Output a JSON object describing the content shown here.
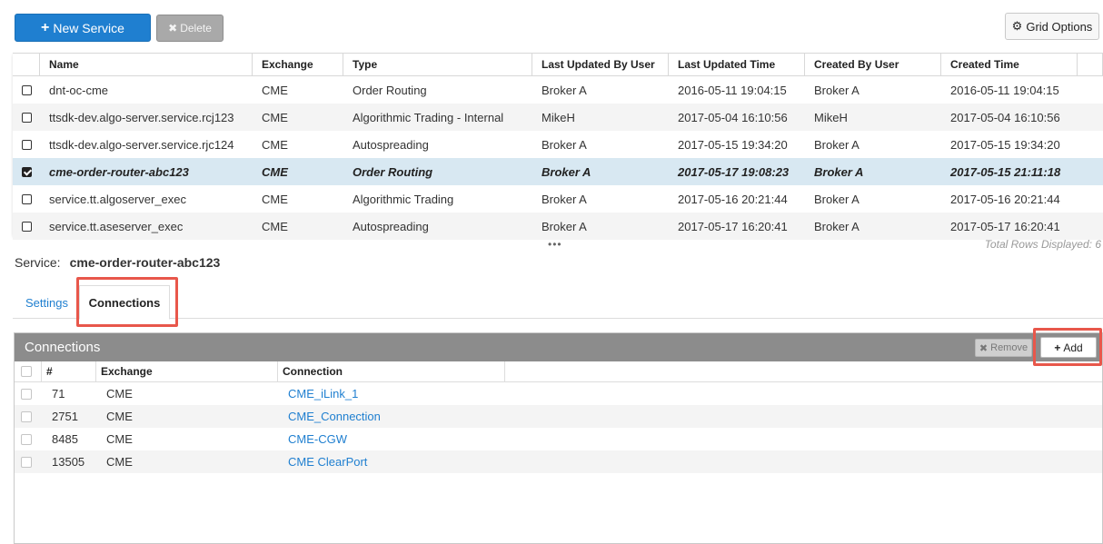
{
  "toolbar": {
    "new_service_label": "New Service",
    "delete_label": "Delete",
    "grid_options_label": "Grid Options"
  },
  "services": {
    "columns": [
      "Name",
      "Exchange",
      "Type",
      "Last Updated By User",
      "Last Updated Time",
      "Created By User",
      "Created Time"
    ],
    "rows": [
      {
        "checked": false,
        "name": "dnt-oc-cme",
        "exchange": "CME",
        "type": "Order Routing",
        "last_updated_by": "Broker A",
        "last_updated_time": "2016-05-11 19:04:15",
        "created_by": "Broker A",
        "created_time": "2016-05-11 19:04:15"
      },
      {
        "checked": false,
        "name": "ttsdk-dev.algo-server.service.rcj123",
        "exchange": "CME",
        "type": "Algorithmic Trading - Internal",
        "last_updated_by": "MikeH",
        "last_updated_time": "2017-05-04 16:10:56",
        "created_by": "MikeH",
        "created_time": "2017-05-04 16:10:56"
      },
      {
        "checked": false,
        "name": "ttsdk-dev.algo-server.service.rjc124",
        "exchange": "CME",
        "type": "Autospreading",
        "last_updated_by": "Broker A",
        "last_updated_time": "2017-05-15 19:34:20",
        "created_by": "Broker A",
        "created_time": "2017-05-15 19:34:20"
      },
      {
        "checked": true,
        "name": "cme-order-router-abc123",
        "exchange": "CME",
        "type": "Order Routing",
        "last_updated_by": "Broker A",
        "last_updated_time": "2017-05-17 19:08:23",
        "created_by": "Broker A",
        "created_time": "2017-05-15 21:11:18"
      },
      {
        "checked": false,
        "name": "service.tt.algoserver_exec",
        "exchange": "CME",
        "type": "Algorithmic Trading",
        "last_updated_by": "Broker A",
        "last_updated_time": "2017-05-16 20:21:44",
        "created_by": "Broker A",
        "created_time": "2017-05-16 20:21:44"
      },
      {
        "checked": false,
        "name": "service.tt.aseserver_exec",
        "exchange": "CME",
        "type": "Autospreading",
        "last_updated_by": "Broker A",
        "last_updated_time": "2017-05-17 16:20:41",
        "created_by": "Broker A",
        "created_time": "2017-05-17 16:20:41"
      }
    ],
    "ellipsis": "•••",
    "total_rows_label": "Total Rows Displayed: 6"
  },
  "service_detail": {
    "label": "Service:",
    "name": "cme-order-router-abc123"
  },
  "tabs": {
    "settings": "Settings",
    "connections": "Connections"
  },
  "connections": {
    "title": "Connections",
    "remove_label": "Remove",
    "add_label": "Add",
    "columns": [
      "#",
      "Exchange",
      "Connection"
    ],
    "rows": [
      {
        "num": "71",
        "exchange": "CME",
        "connection": "CME_iLink_1"
      },
      {
        "num": "2751",
        "exchange": "CME",
        "connection": "CME_Connection"
      },
      {
        "num": "8485",
        "exchange": "CME",
        "connection": "CME-CGW"
      },
      {
        "num": "13505",
        "exchange": "CME",
        "connection": "CME ClearPort"
      }
    ]
  },
  "colors": {
    "primary": "#1f7fd0",
    "selected_row": "#d8e8f2",
    "highlight": "#e8574b",
    "panel_header": "#8c8c8c"
  }
}
